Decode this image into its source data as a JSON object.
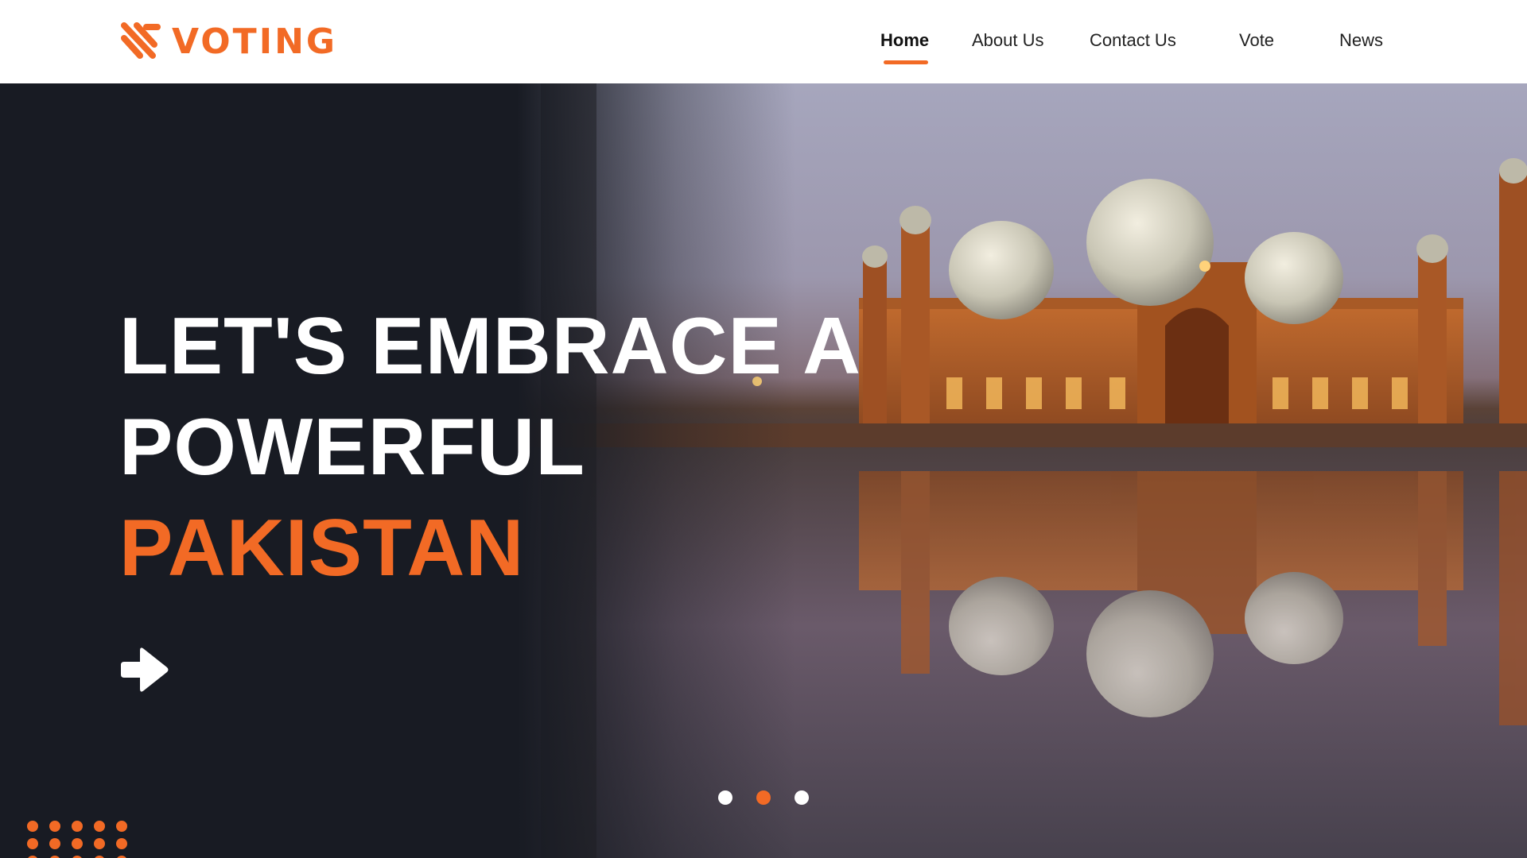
{
  "brand": {
    "name": "VOTING",
    "logo_icon": "stripes-logo-icon",
    "accent_color": "#f26a25"
  },
  "nav": {
    "items": [
      {
        "label": "Home",
        "active": true
      },
      {
        "label": "About Us",
        "active": false
      },
      {
        "label": "Contact Us",
        "active": false
      },
      {
        "label": "Vote",
        "active": false
      },
      {
        "label": "News",
        "active": false
      }
    ]
  },
  "hero": {
    "line1": "LET'S EMBRACE A",
    "line2": "POWERFUL",
    "line3": "PAKISTAN",
    "background_photo": "mosque-reflection-at-dusk",
    "cta_icon": "right-arrow-icon",
    "dark_color": "#181b23"
  },
  "carousel": {
    "slide_count": 3,
    "active_index": 1
  }
}
